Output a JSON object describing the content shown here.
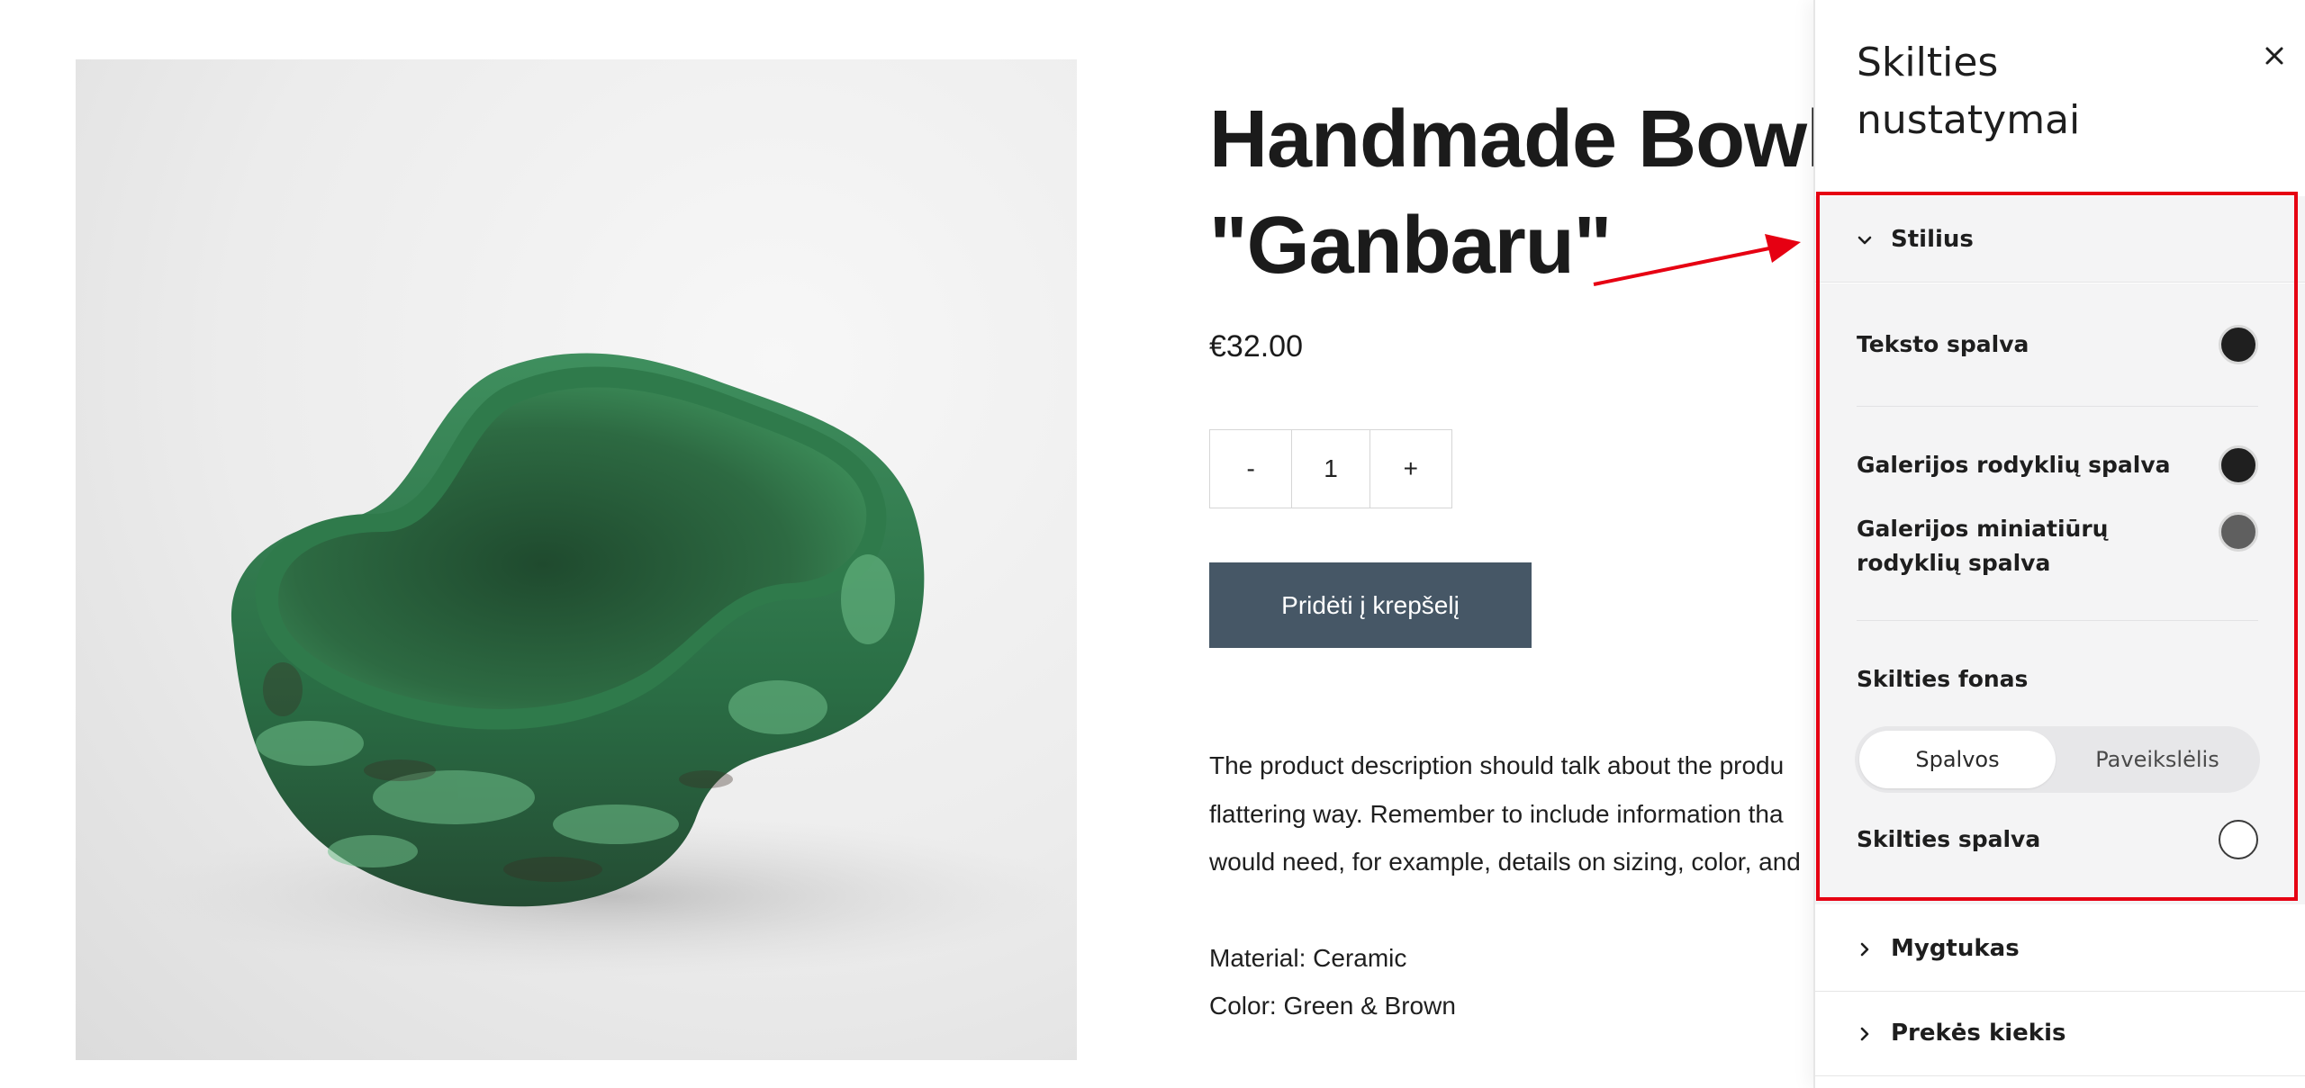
{
  "product": {
    "title": "Handmade Bowl \"Ganbaru\"",
    "price": "€32.00",
    "quantity": {
      "minus_label": "-",
      "value": "1",
      "plus_label": "+"
    },
    "add_to_cart_label": "Pridėti į krepšelį",
    "description_lines": [
      "The product description should talk about the produ",
      "flattering way. Remember to include information tha",
      "would need, for example, details on sizing, color, and"
    ],
    "material": "Material: Ceramic",
    "color": "Color: Green & Brown"
  },
  "panel": {
    "title": "Skilties nustatymai",
    "sections": {
      "style": {
        "label": "Stilius",
        "expanded": true,
        "text_color": {
          "label": "Teksto spalva",
          "value": "#1f1f1f"
        },
        "gallery_arrow_color": {
          "label": "Galerijos rodyklių spalva",
          "value": "#1f1f1f"
        },
        "gallery_thumb_arrow_color": {
          "label": "Galerijos miniatiūrų rodyklių spalva",
          "value": "#5f5f5f"
        },
        "background": {
          "label": "Skilties fonas",
          "options": [
            "Spalvos",
            "Paveikslėlis"
          ],
          "selected": "Spalvos"
        },
        "section_color": {
          "label": "Skilties spalva",
          "value": "#ffffff"
        }
      },
      "button": {
        "label": "Mygtukas",
        "expanded": false
      },
      "quantity": {
        "label": "Prekės kiekis",
        "expanded": false
      }
    }
  },
  "colors": {
    "accent_annotation": "#e60012",
    "add_to_cart_bg": "#465766",
    "panel_section_bg": "#f4f4f5"
  }
}
